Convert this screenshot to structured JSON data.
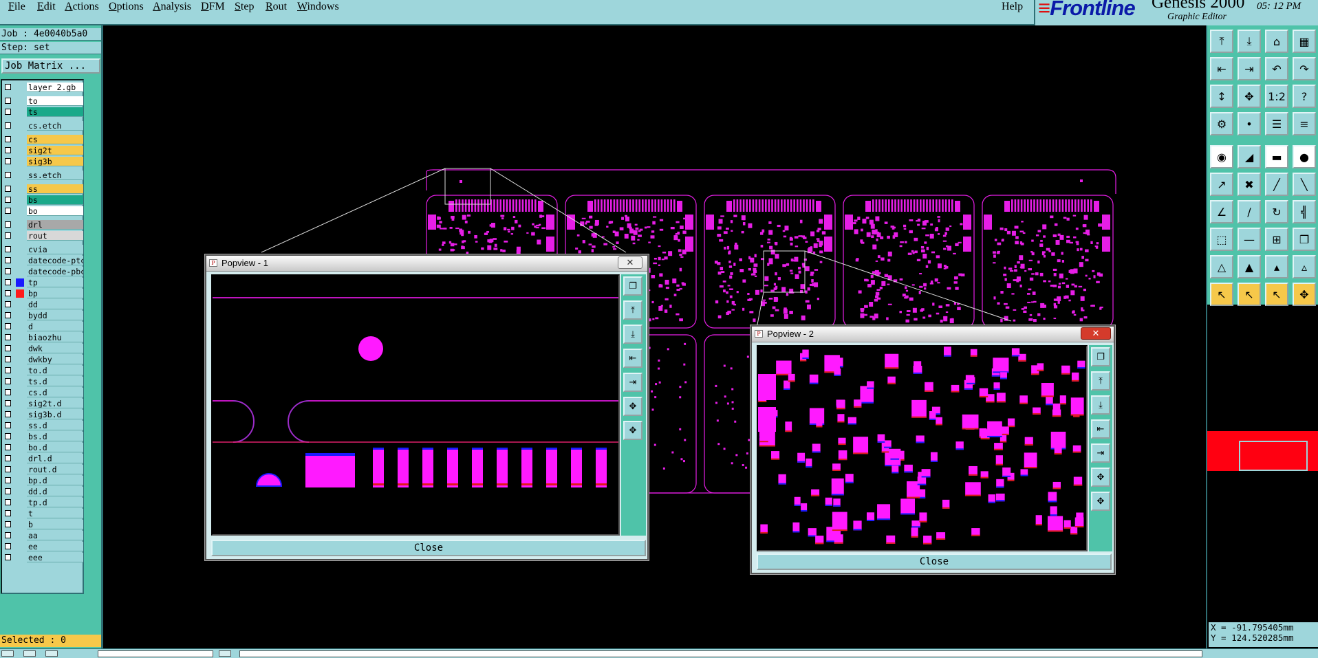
{
  "menu": {
    "items": [
      {
        "u": "F",
        "rest": "ile"
      },
      {
        "u": "E",
        "rest": "dit"
      },
      {
        "u": "A",
        "rest": "ctions"
      },
      {
        "u": "O",
        "rest": "ptions"
      },
      {
        "u": "A",
        "rest": "nalysis"
      },
      {
        "u": "D",
        "rest": "FM"
      },
      {
        "u": "S",
        "rest": "tep"
      },
      {
        "u": "R",
        "rest": "out"
      },
      {
        "u": "W",
        "rest": "indows"
      }
    ],
    "help": "Help"
  },
  "brand": {
    "logo": "Frontline",
    "logo_mark": "≡",
    "product": "Genesis 2000",
    "subtitle": "Graphic Editor",
    "clock": "05: 12  PM"
  },
  "job": {
    "job_label": "Job : 4e0040b5a0",
    "step_label": "Step: set",
    "matrix_button": "Job Matrix ..."
  },
  "layers": [
    {
      "name": "layer_2.gb",
      "bg": "#ffffff",
      "swatch": ""
    },
    {
      "name": "to",
      "bg": "#ffffff",
      "swatch": ""
    },
    {
      "name": "ts",
      "bg": "#1aa98a",
      "swatch": ""
    },
    {
      "name": "cs.etch",
      "bg": "#9ed6db",
      "swatch": ""
    },
    {
      "name": "cs",
      "bg": "#f6c84a",
      "swatch": ""
    },
    {
      "name": "sig2t",
      "bg": "#f6c84a",
      "swatch": ""
    },
    {
      "name": "sig3b",
      "bg": "#f6c84a",
      "swatch": ""
    },
    {
      "name": "ss.etch",
      "bg": "#9ed6db",
      "swatch": ""
    },
    {
      "name": "ss",
      "bg": "#f6c84a",
      "swatch": ""
    },
    {
      "name": "bs",
      "bg": "#1aa98a",
      "swatch": ""
    },
    {
      "name": "bo",
      "bg": "#ffffff",
      "swatch": ""
    },
    {
      "name": "drl",
      "bg": "#a8a8a8",
      "swatch": ""
    },
    {
      "name": "rout",
      "bg": "#d8d8d8",
      "swatch": ""
    },
    {
      "name": "cvia",
      "bg": "#9ed6db",
      "swatch": ""
    },
    {
      "name": "datecode-ptc",
      "bg": "#9ed6db",
      "swatch": ""
    },
    {
      "name": "datecode-pbc",
      "bg": "#9ed6db",
      "swatch": ""
    },
    {
      "name": "tp",
      "bg": "#9ed6db",
      "swatch": "#1a1aff"
    },
    {
      "name": "bp",
      "bg": "#9ed6db",
      "swatch": "#ff1a1a"
    },
    {
      "name": "dd",
      "bg": "#9ed6db",
      "swatch": ""
    },
    {
      "name": "bydd",
      "bg": "#9ed6db",
      "swatch": ""
    },
    {
      "name": "d",
      "bg": "#9ed6db",
      "swatch": ""
    },
    {
      "name": "biaozhu",
      "bg": "#9ed6db",
      "swatch": ""
    },
    {
      "name": "dwk",
      "bg": "#9ed6db",
      "swatch": ""
    },
    {
      "name": "dwkby",
      "bg": "#9ed6db",
      "swatch": ""
    },
    {
      "name": "to.d",
      "bg": "#9ed6db",
      "swatch": ""
    },
    {
      "name": "ts.d",
      "bg": "#9ed6db",
      "swatch": ""
    },
    {
      "name": "cs.d",
      "bg": "#9ed6db",
      "swatch": ""
    },
    {
      "name": "sig2t.d",
      "bg": "#9ed6db",
      "swatch": ""
    },
    {
      "name": "sig3b.d",
      "bg": "#9ed6db",
      "swatch": ""
    },
    {
      "name": "ss.d",
      "bg": "#9ed6db",
      "swatch": ""
    },
    {
      "name": "bs.d",
      "bg": "#9ed6db",
      "swatch": ""
    },
    {
      "name": "bo.d",
      "bg": "#9ed6db",
      "swatch": ""
    },
    {
      "name": "drl.d",
      "bg": "#9ed6db",
      "swatch": ""
    },
    {
      "name": "rout.d",
      "bg": "#9ed6db",
      "swatch": ""
    },
    {
      "name": "bp.d",
      "bg": "#9ed6db",
      "swatch": ""
    },
    {
      "name": "dd.d",
      "bg": "#9ed6db",
      "swatch": ""
    },
    {
      "name": "tp.d",
      "bg": "#9ed6db",
      "swatch": ""
    },
    {
      "name": "t",
      "bg": "#9ed6db",
      "swatch": ""
    },
    {
      "name": "b",
      "bg": "#9ed6db",
      "swatch": ""
    },
    {
      "name": "aa",
      "bg": "#9ed6db",
      "swatch": ""
    },
    {
      "name": "ee",
      "bg": "#9ed6db",
      "swatch": ""
    },
    {
      "name": "eee",
      "bg": "#9ed6db",
      "swatch": ""
    }
  ],
  "selected": "Selected : 0",
  "coords": {
    "x": "X = -91.795405mm",
    "y": "Y = 124.520285mm"
  },
  "tools": [
    {
      "icon": "⤒",
      "name": "load-layer-icon",
      "style": ""
    },
    {
      "icon": "⤓",
      "name": "save-layer-icon",
      "style": ""
    },
    {
      "icon": "⌂",
      "name": "home-icon",
      "style": ""
    },
    {
      "icon": "▦",
      "name": "grid-icon",
      "style": ""
    },
    {
      "icon": "⇤",
      "name": "pan-left-icon",
      "style": ""
    },
    {
      "icon": "⇥",
      "name": "pan-right-icon",
      "style": ""
    },
    {
      "icon": "↶",
      "name": "undo-icon",
      "style": ""
    },
    {
      "icon": "↷",
      "name": "redo-icon",
      "style": ""
    },
    {
      "icon": "↕",
      "name": "zoom-fit-icon",
      "style": ""
    },
    {
      "icon": "✥",
      "name": "zoom-area-icon",
      "style": ""
    },
    {
      "icon": "1:2",
      "name": "scale-icon",
      "style": ""
    },
    {
      "icon": "?",
      "name": "help-icon",
      "style": ""
    },
    {
      "icon": "⚙",
      "name": "settings-icon",
      "style": ""
    },
    {
      "icon": "•",
      "name": "snap-icon",
      "style": ""
    },
    {
      "icon": "☰",
      "name": "layers-icon",
      "style": ""
    },
    {
      "icon": "≡",
      "name": "list-icon",
      "style": ""
    },
    {
      "icon": "◉",
      "name": "pad-icon",
      "style": "white"
    },
    {
      "icon": "◢",
      "name": "fill-icon",
      "style": ""
    },
    {
      "icon": "▬",
      "name": "line-icon",
      "style": "white"
    },
    {
      "icon": "●",
      "name": "dot-icon",
      "style": "white"
    },
    {
      "icon": "↗",
      "name": "connect-icon",
      "style": ""
    },
    {
      "icon": "✖",
      "name": "delete-icon",
      "style": ""
    },
    {
      "icon": "╱",
      "name": "diagonal-icon",
      "style": ""
    },
    {
      "icon": "╲",
      "name": "diagonal2-icon",
      "style": ""
    },
    {
      "icon": "∠",
      "name": "angle-icon",
      "style": ""
    },
    {
      "icon": "∕",
      "name": "slash-icon",
      "style": ""
    },
    {
      "icon": "↻",
      "name": "rotate-icon",
      "style": ""
    },
    {
      "icon": "╣",
      "name": "align-icon",
      "style": ""
    },
    {
      "icon": "⬚",
      "name": "select-box-icon",
      "style": ""
    },
    {
      "icon": "—",
      "name": "dash-icon",
      "style": ""
    },
    {
      "icon": "⊞",
      "name": "measure-icon",
      "style": ""
    },
    {
      "icon": "❐",
      "name": "copy-icon",
      "style": ""
    },
    {
      "icon": "△",
      "name": "triangle-icon",
      "style": ""
    },
    {
      "icon": "▲",
      "name": "triangle-filled-icon",
      "style": ""
    },
    {
      "icon": "▴",
      "name": "triangle-small-icon",
      "style": ""
    },
    {
      "icon": "▵",
      "name": "triangle-outline-icon",
      "style": ""
    },
    {
      "icon": "↖",
      "name": "pointer-icon",
      "style": "orange"
    },
    {
      "icon": "↖",
      "name": "pointer-alt-icon",
      "style": "orange"
    },
    {
      "icon": "↖",
      "name": "pointer-sub-icon",
      "style": "orange"
    },
    {
      "icon": "✥",
      "name": "move-icon",
      "style": "orange"
    }
  ],
  "popview1": {
    "title": "Popview - 1",
    "close_label": "Close",
    "close_x": "✕"
  },
  "popview2": {
    "title": "Popview - 2",
    "close_label": "Close",
    "close_x": "✕"
  },
  "colors": {
    "accent": "#9ed6db",
    "panel": "#4fc3a9",
    "copper": "#ff00ff"
  }
}
